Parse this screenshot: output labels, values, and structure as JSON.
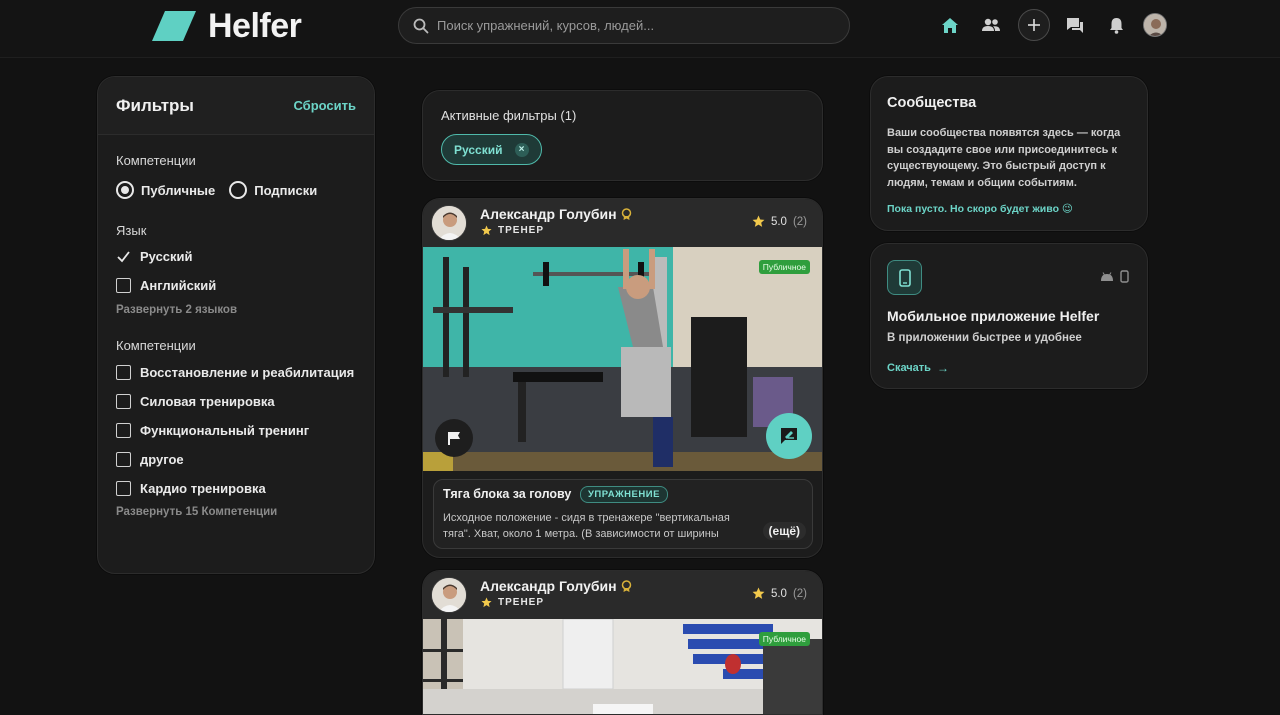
{
  "header": {
    "brand": "Helfer",
    "search_placeholder": "Поиск упражнений, курсов, людей..."
  },
  "filters": {
    "title": "Фильтры",
    "reset": "Сбросить",
    "competencies_label": "Компетенции",
    "radio_options": [
      {
        "label": "Публичные",
        "selected": true
      },
      {
        "label": "Подписки",
        "selected": false
      }
    ],
    "language_label": "Язык",
    "languages": [
      {
        "label": "Русский",
        "checked": true
      },
      {
        "label": "Английский",
        "checked": false
      }
    ],
    "expand_languages": "Развернуть 2 языков",
    "competencies_label_2": "Компетенции",
    "competencies": [
      {
        "label": "Восстановление и реабилитация",
        "checked": false
      },
      {
        "label": "Силовая тренировка",
        "checked": false
      },
      {
        "label": "Функциональный тренинг",
        "checked": false
      },
      {
        "label": "другое",
        "checked": false
      },
      {
        "label": "Кардио тренировка",
        "checked": false
      }
    ],
    "expand_competencies": "Развернуть 15 Компетенции"
  },
  "active_filters": {
    "title": "Активные фильтры (1)",
    "chips": [
      {
        "label": "Русский",
        "remove": "×"
      }
    ]
  },
  "posts": [
    {
      "author": "Александр Голубин",
      "role": "ТРЕНЕР",
      "rating": "5.0",
      "rating_count": "(2)",
      "visibility": "Публичное",
      "title": "Тяга блока за голову",
      "tag": "УПРАЖНЕНИЕ",
      "description": "Исходное положение - сидя в тренажере \"вертикальная тяга\". Хват, около 1 метра. (В зависимости от ширины",
      "more": "(ещё)"
    },
    {
      "author": "Александр Голубин",
      "role": "ТРЕНЕР",
      "rating": "5.0",
      "rating_count": "(2)",
      "visibility": "Публичное"
    }
  ],
  "communities": {
    "title": "Сообщества",
    "text": "Ваши сообщества появятся здесь — когда вы создадите свое или присоединитесь к существующему. Это быстрый доступ к людям, темам и общим событиям.",
    "empty": "Пока пусто. Но скоро будет живо 😉"
  },
  "mobile_app": {
    "title": "Мобильное приложение Helfer",
    "subtitle": "В приложении быстрее и удобнее",
    "download": "Скачать",
    "arrow": "→"
  },
  "colors": {
    "accent": "#6cd4c7",
    "background": "#121212",
    "panel": "#1c1c1c",
    "badge_public": "#2f9e3d",
    "star": "#f2c94c"
  }
}
